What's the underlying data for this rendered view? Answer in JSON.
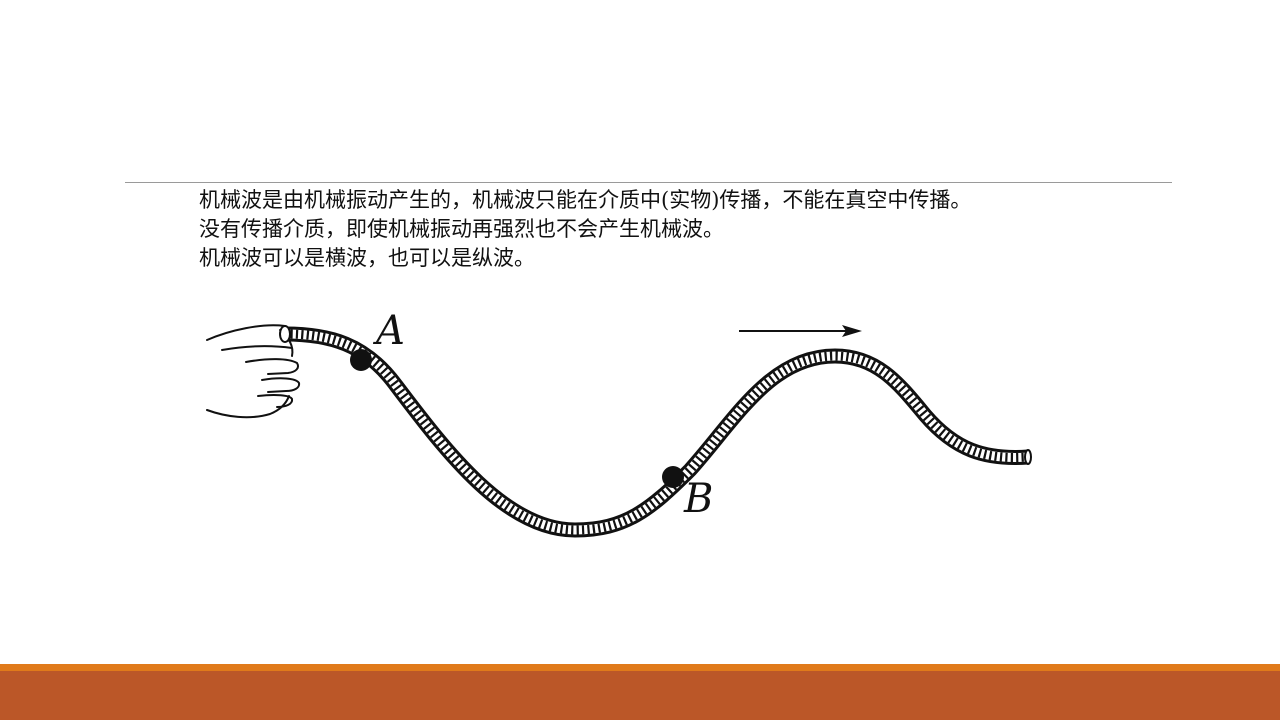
{
  "slide": {
    "lines": [
      "机械波是由机械振动产生的，机械波只能在介质中(实物)传播，不能在真空中传播。",
      "没有传播介质，即使机械振动再强烈也不会产生机械波。",
      "机械波可以是横波，也可以是纵波。"
    ]
  },
  "figure": {
    "point_a_label": "A",
    "point_b_label": "B"
  },
  "colors": {
    "footer_band": "#bb5728",
    "footer_accent": "#e07a1a",
    "divider": "#9a9a9a"
  }
}
